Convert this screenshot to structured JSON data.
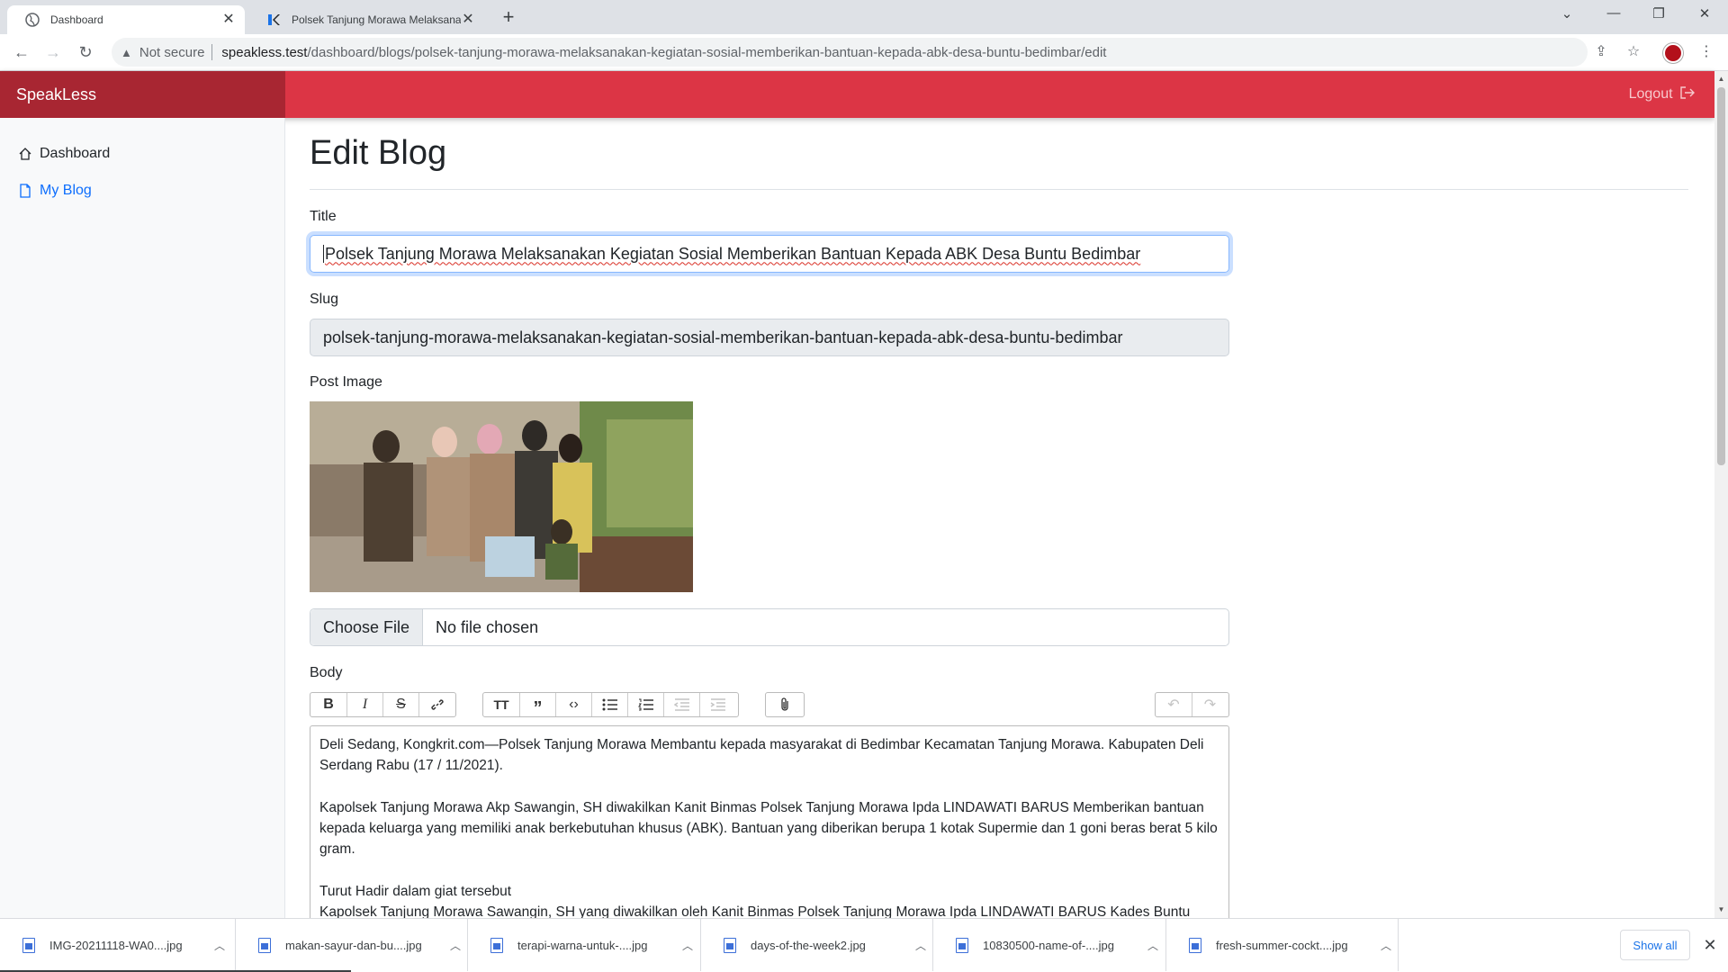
{
  "browser": {
    "tabs": [
      {
        "title": "Dashboard",
        "active": true
      },
      {
        "title": "Polsek Tanjung Morawa Melaksanakan",
        "active": false
      }
    ],
    "address": {
      "security_label": "Not secure",
      "host": "speakless.test",
      "path": "/dashboard/blogs/polsek-tanjung-morawa-melaksanakan-kegiatan-sosial-memberikan-bantuan-kepada-abk-desa-buntu-bedimbar/edit"
    }
  },
  "app": {
    "brand": "SpeakLess",
    "logout_label": "Logout",
    "accent_color": "#dc3545",
    "brand_bg": "#a82632"
  },
  "sidebar": {
    "items": [
      {
        "label": "Dashboard",
        "icon": "house-icon",
        "active": false
      },
      {
        "label": "My Blog",
        "icon": "file-icon",
        "active": true
      }
    ]
  },
  "form": {
    "heading": "Edit Blog",
    "title_label": "Title",
    "title_value": "Polsek Tanjung Morawa Melaksanakan Kegiatan Sosial Memberikan Bantuan Kepada ABK Desa Buntu Bedimbar",
    "slug_label": "Slug",
    "slug_value": "polsek-tanjung-morawa-melaksanakan-kegiatan-sosial-memberikan-bantuan-kepada-abk-desa-buntu-bedimbar",
    "image_label": "Post Image",
    "choose_file_label": "Choose File",
    "no_file_label": "No file chosen",
    "body_label": "Body",
    "body_paragraphs": [
      "Deli Sedang, Kongkrit.com—Polsek Tanjung Morawa Membantu kepada masyarakat di Bedimbar Kecamatan Tanjung Morawa. Kabupaten Deli Serdang Rabu (17 / 11/2021).",
      "Kapolsek Tanjung Morawa Akp Sawangin, SH diwakilkan Kanit Binmas Polsek Tanjung Morawa Ipda LINDAWATI BARUS Memberikan bantuan kepada keluarga yang memiliki anak berkebutuhan khusus (ABK). Bantuan yang diberikan berupa 1 kotak Supermie dan 1 goni beras berat 5 kilo gram.",
      "Turut Hadir dalam giat tersebut",
      "Kapolsek Tanjung Morawa Sawangin, SH yang diwakilkan oleh Kanit Binmas Polsek Tanjung Morawa Ipda LINDAWATI BARUS Kades Buntu"
    ]
  },
  "downloads": {
    "items": [
      "IMG-20211118-WA0....jpg",
      "makan-sayur-dan-bu....jpg",
      "terapi-warna-untuk-....jpg",
      "days-of-the-week2.jpg",
      "10830500-name-of-....jpg",
      "fresh-summer-cockt....jpg"
    ],
    "show_all_label": "Show all"
  }
}
